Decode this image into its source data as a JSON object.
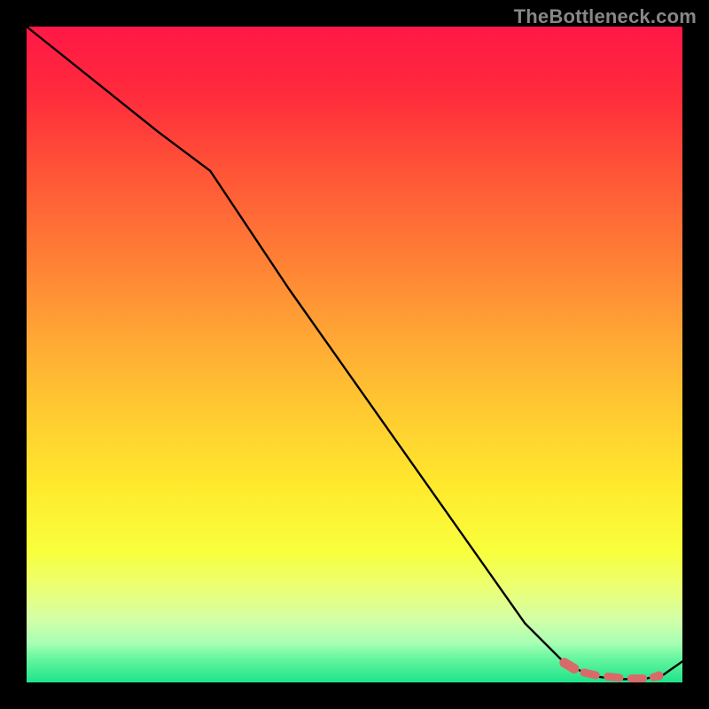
{
  "attribution": "TheBottleneck.com",
  "colors": {
    "background": "#000000",
    "gradient_stops": [
      {
        "offset": 0.0,
        "color": "#ff1846"
      },
      {
        "offset": 0.1,
        "color": "#ff2a3c"
      },
      {
        "offset": 0.22,
        "color": "#ff5437"
      },
      {
        "offset": 0.35,
        "color": "#ff7e35"
      },
      {
        "offset": 0.48,
        "color": "#ffa935"
      },
      {
        "offset": 0.58,
        "color": "#ffc831"
      },
      {
        "offset": 0.7,
        "color": "#ffe92d"
      },
      {
        "offset": 0.8,
        "color": "#f8ff3c"
      },
      {
        "offset": 0.86,
        "color": "#eaff78"
      },
      {
        "offset": 0.905,
        "color": "#d2ffa8"
      },
      {
        "offset": 0.94,
        "color": "#a7ffb4"
      },
      {
        "offset": 0.965,
        "color": "#63f59e"
      },
      {
        "offset": 1.0,
        "color": "#1ee38b"
      }
    ],
    "curve": "#000000",
    "overlay_marker": "#d86b6a"
  },
  "chart_data": {
    "type": "line",
    "title": "",
    "xlabel": "",
    "ylabel": "",
    "xlim": [
      0,
      100
    ],
    "ylim": [
      0,
      100
    ],
    "series": [
      {
        "name": "bottleneck-curve",
        "x": [
          0,
          10,
          20,
          28,
          40,
          52,
          64,
          76,
          82,
          86,
          90,
          94,
          97,
          100
        ],
        "y": [
          100,
          92,
          84,
          78,
          60,
          43,
          26,
          9,
          3,
          1,
          0.5,
          0.5,
          1.1,
          3.2
        ]
      }
    ],
    "overlay": {
      "name": "highlight-dashes",
      "render": "dashed",
      "x": [
        82.0,
        83.5,
        85.0,
        86.8,
        88.6,
        90.4,
        92.2,
        94.0,
        95.6,
        96.4
      ],
      "y": [
        3.0,
        2.1,
        1.5,
        1.1,
        0.9,
        0.7,
        0.6,
        0.6,
        0.8,
        1.0
      ]
    },
    "overlay_point": {
      "x": 96.4,
      "y": 1.0
    }
  }
}
